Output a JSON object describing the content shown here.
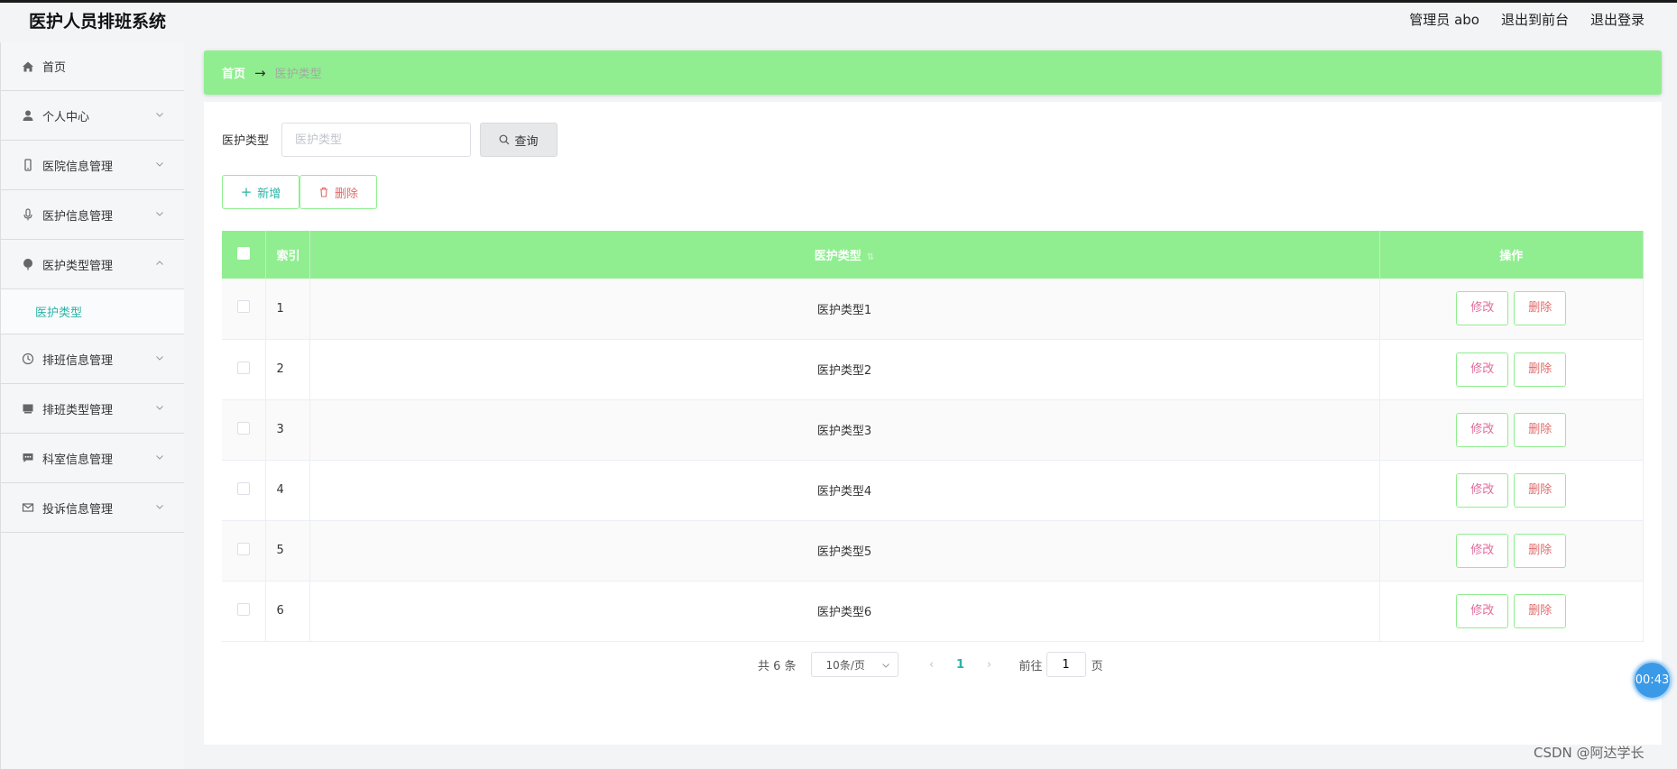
{
  "header": {
    "title": "医护人员排班系统",
    "admin_label": "管理员 abo",
    "front_link": "退出到前台",
    "logout_link": "退出登录"
  },
  "sidebar": {
    "items": [
      {
        "label": "首页",
        "icon": "home-icon"
      },
      {
        "label": "个人中心",
        "icon": "user-icon"
      },
      {
        "label": "医院信息管理",
        "icon": "phone-icon"
      },
      {
        "label": "医护信息管理",
        "icon": "microphone-icon"
      },
      {
        "label": "医护类型管理",
        "icon": "globe-icon"
      },
      {
        "label": "排班信息管理",
        "icon": "clock-icon"
      },
      {
        "label": "排班类型管理",
        "icon": "box-icon"
      },
      {
        "label": "科室信息管理",
        "icon": "chat-icon"
      },
      {
        "label": "投诉信息管理",
        "icon": "mail-icon"
      }
    ],
    "submenu": {
      "label": "医护类型"
    }
  },
  "breadcrumb": {
    "home": "首页",
    "arrow": "→",
    "current": "医护类型"
  },
  "search": {
    "label": "医护类型",
    "placeholder": "医护类型",
    "value": "",
    "button": "查询"
  },
  "actions": {
    "add": "新增",
    "delete": "删除"
  },
  "table": {
    "columns": {
      "index": "索引",
      "type": "医护类型",
      "ops": "操作"
    },
    "rows": [
      {
        "index": "1",
        "type": "医护类型1"
      },
      {
        "index": "2",
        "type": "医护类型2"
      },
      {
        "index": "3",
        "type": "医护类型3"
      },
      {
        "index": "4",
        "type": "医护类型4"
      },
      {
        "index": "5",
        "type": "医护类型5"
      },
      {
        "index": "6",
        "type": "医护类型6"
      }
    ],
    "edit_label": "修改",
    "delete_label": "删除"
  },
  "pagination": {
    "total": "共 6 条",
    "page_size": "10条/页",
    "current": "1",
    "goto_prefix": "前往",
    "goto_value": "1",
    "goto_suffix": "页"
  },
  "overlay": {
    "timer": "00:43",
    "watermark": "CSDN @阿达学长"
  },
  "colors": {
    "accent_green": "#90ee90",
    "teal": "#2bb3a6",
    "danger": "#e06b6b",
    "timer_blue": "#3b9ae8"
  }
}
